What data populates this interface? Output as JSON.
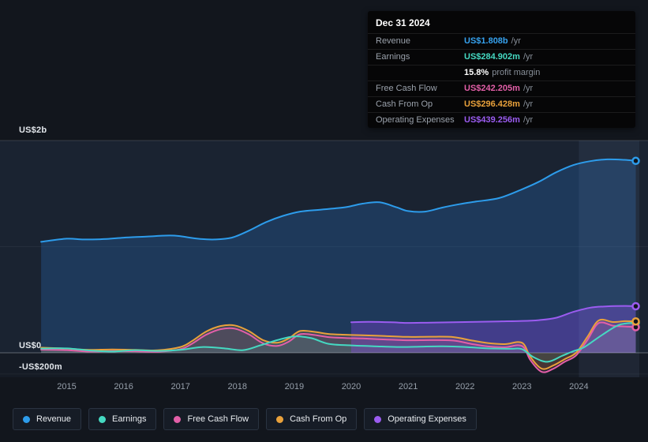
{
  "tooltip": {
    "date": "Dec 31 2024",
    "rows": [
      {
        "label": "Revenue",
        "value": "US$1.808b",
        "suffix": "/yr",
        "color": "#36A2EF"
      },
      {
        "label": "Earnings",
        "value": "US$284.902m",
        "suffix": "/yr",
        "color": "#45D9C2"
      },
      {
        "label": "",
        "value": "15.8%",
        "suffix": "profit margin",
        "color": "#FFFFFF"
      },
      {
        "label": "Free Cash Flow",
        "value": "US$242.205m",
        "suffix": "/yr",
        "color": "#E35FA8"
      },
      {
        "label": "Cash From Op",
        "value": "US$296.428m",
        "suffix": "/yr",
        "color": "#E9A13B"
      },
      {
        "label": "Operating Expenses",
        "value": "US$439.256m",
        "suffix": "/yr",
        "color": "#9B5CF0"
      }
    ]
  },
  "axis": {
    "y_top": "US$2b",
    "y_zero": "US$0",
    "y_neg": "-US$200m",
    "years": [
      "2015",
      "2016",
      "2017",
      "2018",
      "2019",
      "2020",
      "2021",
      "2022",
      "2023",
      "2024"
    ]
  },
  "legend": [
    {
      "label": "Revenue",
      "color": "#2D9CEB"
    },
    {
      "label": "Earnings",
      "color": "#45D9C2"
    },
    {
      "label": "Free Cash Flow",
      "color": "#E35FA8"
    },
    {
      "label": "Cash From Op",
      "color": "#E9A13B"
    },
    {
      "label": "Operating Expenses",
      "color": "#9B5CF0"
    }
  ],
  "chart_data": {
    "type": "area",
    "title": "Revenue & Expenses History (US$ millions, by year)",
    "x_unit": "year",
    "y_unit": "US$ millions",
    "ylim": [
      -230,
      2000
    ],
    "x_ticks": [
      2015,
      2016,
      2017,
      2018,
      2019,
      2020,
      2021,
      2022,
      2023,
      2024
    ],
    "y_grid_values": [
      2000,
      1000,
      0,
      -200
    ],
    "highlight_band_from_year": 2024,
    "legend_position": "bottom",
    "series": [
      {
        "name": "Revenue",
        "color": "#2D9CEB",
        "fill": "rgba(40,110,185,0.30)",
        "points": [
          [
            2014.55,
            1045
          ],
          [
            2015,
            1075
          ],
          [
            2015.3,
            1068
          ],
          [
            2015.7,
            1072
          ],
          [
            2016,
            1085
          ],
          [
            2016.4,
            1095
          ],
          [
            2016.8,
            1105
          ],
          [
            2017,
            1098
          ],
          [
            2017.3,
            1075
          ],
          [
            2017.6,
            1068
          ],
          [
            2017.9,
            1085
          ],
          [
            2018.2,
            1150
          ],
          [
            2018.5,
            1230
          ],
          [
            2018.8,
            1290
          ],
          [
            2019.1,
            1330
          ],
          [
            2019.5,
            1350
          ],
          [
            2019.9,
            1372
          ],
          [
            2020.2,
            1405
          ],
          [
            2020.5,
            1418
          ],
          [
            2020.8,
            1370
          ],
          [
            2021,
            1335
          ],
          [
            2021.3,
            1330
          ],
          [
            2021.6,
            1368
          ],
          [
            2021.9,
            1400
          ],
          [
            2022.2,
            1425
          ],
          [
            2022.6,
            1458
          ],
          [
            2023,
            1540
          ],
          [
            2023.3,
            1612
          ],
          [
            2023.6,
            1700
          ],
          [
            2023.9,
            1768
          ],
          [
            2024.2,
            1805
          ],
          [
            2024.5,
            1822
          ],
          [
            2024.8,
            1818
          ],
          [
            2025,
            1808
          ]
        ]
      },
      {
        "name": "Earnings",
        "color": "#45D9C2",
        "fill": "rgba(69,217,194,0.10)",
        "points": [
          [
            2014.55,
            40
          ],
          [
            2015,
            42
          ],
          [
            2015.4,
            22
          ],
          [
            2015.8,
            12
          ],
          [
            2016.2,
            25
          ],
          [
            2016.6,
            18
          ],
          [
            2017,
            28
          ],
          [
            2017.4,
            55
          ],
          [
            2017.8,
            40
          ],
          [
            2018.1,
            25
          ],
          [
            2018.4,
            70
          ],
          [
            2018.7,
            120
          ],
          [
            2019,
            155
          ],
          [
            2019.3,
            138
          ],
          [
            2019.6,
            85
          ],
          [
            2020,
            70
          ],
          [
            2020.4,
            62
          ],
          [
            2020.8,
            55
          ],
          [
            2021.2,
            58
          ],
          [
            2021.6,
            62
          ],
          [
            2022,
            55
          ],
          [
            2022.4,
            42
          ],
          [
            2022.8,
            38
          ],
          [
            2023,
            35
          ],
          [
            2023.2,
            -40
          ],
          [
            2023.45,
            -85
          ],
          [
            2023.7,
            -30
          ],
          [
            2023.9,
            15
          ],
          [
            2024.1,
            55
          ],
          [
            2024.4,
            165
          ],
          [
            2024.7,
            262
          ],
          [
            2025,
            285
          ]
        ]
      },
      {
        "name": "Free Cash Flow",
        "color": "#E35FA8",
        "fill": "rgba(227,95,168,0.10)",
        "points": [
          [
            2014.55,
            30
          ],
          [
            2015,
            25
          ],
          [
            2015.4,
            12
          ],
          [
            2015.8,
            16
          ],
          [
            2016.2,
            14
          ],
          [
            2016.6,
            10
          ],
          [
            2017,
            35
          ],
          [
            2017.2,
            85
          ],
          [
            2017.45,
            170
          ],
          [
            2017.7,
            222
          ],
          [
            2017.95,
            228
          ],
          [
            2018.2,
            175
          ],
          [
            2018.45,
            90
          ],
          [
            2018.7,
            65
          ],
          [
            2018.9,
            105
          ],
          [
            2019.1,
            175
          ],
          [
            2019.35,
            168
          ],
          [
            2019.6,
            148
          ],
          [
            2019.9,
            140
          ],
          [
            2020.2,
            135
          ],
          [
            2020.6,
            126
          ],
          [
            2021,
            118
          ],
          [
            2021.4,
            120
          ],
          [
            2021.8,
            115
          ],
          [
            2022.1,
            85
          ],
          [
            2022.4,
            60
          ],
          [
            2022.7,
            52
          ],
          [
            2023,
            65
          ],
          [
            2023.15,
            -70
          ],
          [
            2023.35,
            -180
          ],
          [
            2023.55,
            -150
          ],
          [
            2023.75,
            -85
          ],
          [
            2023.95,
            -25
          ],
          [
            2024.15,
            120
          ],
          [
            2024.35,
            280
          ],
          [
            2024.6,
            255
          ],
          [
            2024.8,
            248
          ],
          [
            2025,
            242
          ]
        ]
      },
      {
        "name": "Cash From Op",
        "color": "#E9A13B",
        "fill": "rgba(233,161,59,0.16)",
        "points": [
          [
            2014.55,
            48
          ],
          [
            2015,
            40
          ],
          [
            2015.4,
            28
          ],
          [
            2015.8,
            32
          ],
          [
            2016.2,
            28
          ],
          [
            2016.6,
            24
          ],
          [
            2017,
            55
          ],
          [
            2017.2,
            110
          ],
          [
            2017.45,
            200
          ],
          [
            2017.7,
            252
          ],
          [
            2017.95,
            258
          ],
          [
            2018.2,
            205
          ],
          [
            2018.45,
            120
          ],
          [
            2018.7,
            95
          ],
          [
            2018.9,
            135
          ],
          [
            2019.1,
            205
          ],
          [
            2019.35,
            198
          ],
          [
            2019.6,
            178
          ],
          [
            2019.9,
            170
          ],
          [
            2020.2,
            165
          ],
          [
            2020.6,
            158
          ],
          [
            2021,
            150
          ],
          [
            2021.4,
            152
          ],
          [
            2021.8,
            148
          ],
          [
            2022.1,
            118
          ],
          [
            2022.4,
            92
          ],
          [
            2022.7,
            82
          ],
          [
            2023,
            95
          ],
          [
            2023.15,
            -40
          ],
          [
            2023.35,
            -150
          ],
          [
            2023.55,
            -120
          ],
          [
            2023.75,
            -60
          ],
          [
            2023.95,
            0
          ],
          [
            2024.15,
            150
          ],
          [
            2024.35,
            305
          ],
          [
            2024.6,
            290
          ],
          [
            2024.8,
            298
          ],
          [
            2025,
            296
          ]
        ]
      },
      {
        "name": "Operating Expenses",
        "color": "#9B5CF0",
        "fill": "rgba(135,70,230,0.35)",
        "points": [
          [
            2020,
            288
          ],
          [
            2020.3,
            292
          ],
          [
            2020.7,
            288
          ],
          [
            2021,
            282
          ],
          [
            2021.4,
            285
          ],
          [
            2021.8,
            288
          ],
          [
            2022.2,
            292
          ],
          [
            2022.6,
            296
          ],
          [
            2023,
            300
          ],
          [
            2023.3,
            308
          ],
          [
            2023.6,
            330
          ],
          [
            2023.9,
            385
          ],
          [
            2024.2,
            425
          ],
          [
            2024.5,
            438
          ],
          [
            2024.8,
            442
          ],
          [
            2025,
            439
          ]
        ]
      }
    ]
  }
}
